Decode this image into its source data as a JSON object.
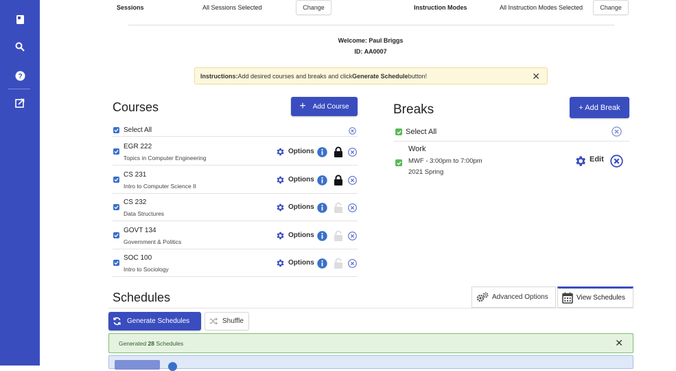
{
  "sidebar": {
    "icons": [
      "book-icon",
      "search-icon",
      "help-icon",
      "external-link-icon"
    ]
  },
  "filters": {
    "sessions_label": "Sessions",
    "sessions_value": "All Sessions Selected",
    "sessions_change": "Change",
    "modes_label": "Instruction Modes",
    "modes_value": "All Instruction Modes Selected",
    "modes_change": "Change"
  },
  "user": {
    "welcome": "Welcome: Paul Briggs",
    "id": "ID: AA0007"
  },
  "instructions": {
    "prefix": "Instructions:",
    "text": " Add desired courses and breaks and click ",
    "emph": "Generate Schedule",
    "suffix": " button!"
  },
  "courses": {
    "title": "Courses",
    "add_label": "Add Course",
    "select_all": "Select All",
    "options_label": "Options",
    "items": [
      {
        "code": "EGR 222",
        "name": "Topics in Computer Engineering",
        "locked": true
      },
      {
        "code": "CS 231",
        "name": "Intro to Computer Science II",
        "locked": true
      },
      {
        "code": "CS 232",
        "name": "Data Structures",
        "locked": false
      },
      {
        "code": "GOVT 134",
        "name": "Government & Politics",
        "locked": false
      },
      {
        "code": "SOC 100",
        "name": "Intro to Sociology",
        "locked": false
      }
    ]
  },
  "breaks": {
    "title": "Breaks",
    "add_label": "+ Add Break",
    "select_all": "Select All",
    "items": [
      {
        "name": "Work",
        "time": "MWF - 3:00pm to 7:00pm",
        "term": "2021 Spring",
        "edit_label": "Edit"
      }
    ]
  },
  "schedules": {
    "title": "Schedules",
    "advanced_label": "Advanced Options",
    "view_label": "View Schedules",
    "generate_label": "Generate Schedules",
    "shuffle_label": "Shuffle",
    "generated_prefix": "Generated ",
    "generated_count": "28",
    "generated_suffix": " Schedules"
  },
  "colors": {
    "primary": "#3a4dbf",
    "info": "#3a70c9",
    "success_bg": "#e4f3df"
  }
}
